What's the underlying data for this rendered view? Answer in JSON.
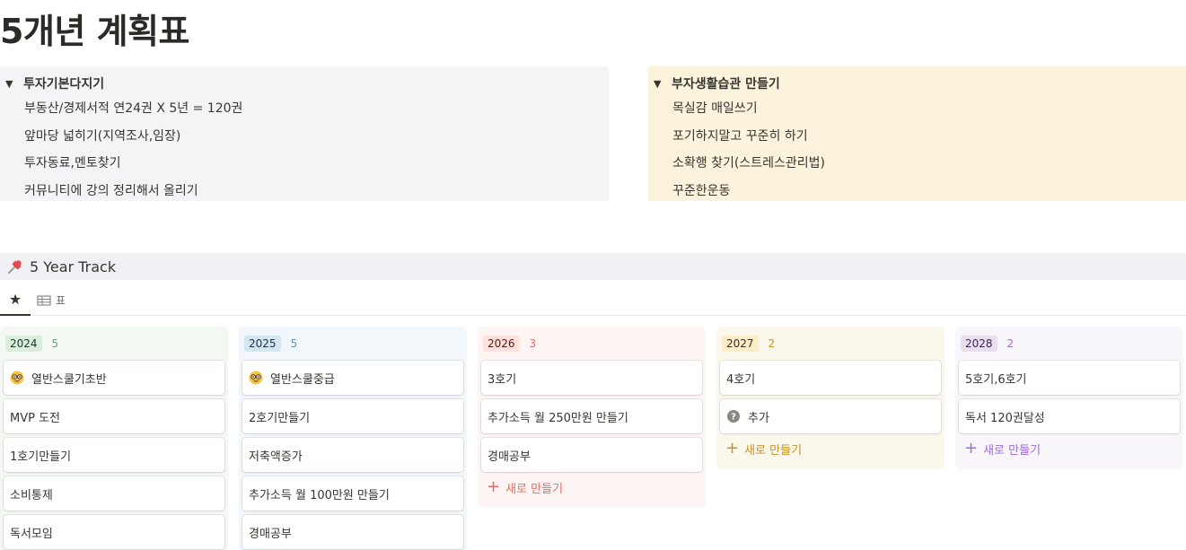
{
  "page": {
    "title": "5개년 계획표"
  },
  "toggles": [
    {
      "title": "투자기본다지기",
      "items": [
        "부동산/경제서적 연24권 X 5년 = 120권",
        "앞마당 넓히기(지역조사,임장)",
        "투자동료,멘토찾기",
        "커뮤니티에 강의 정리해서 올리기"
      ]
    },
    {
      "title": "부자생활습관 만들기",
      "items": [
        "목실감 매일쓰기",
        "포기하지말고 꾸준히 하기",
        "소확행 찾기(스트레스관리법)",
        "꾸준한운동"
      ]
    }
  ],
  "database": {
    "icon": "pushpin-icon",
    "title": "5 Year Track",
    "views": [
      {
        "icon": "star-icon",
        "label": ""
      },
      {
        "icon": "table-icon",
        "label": "표"
      }
    ]
  },
  "board": {
    "add_label": "새로 만들기",
    "columns": [
      {
        "label": "2024",
        "count": "5",
        "colors": {
          "bg": "#f4f8f3",
          "badge_bg": "#dbeddb",
          "badge_text": "#1c3829",
          "count_text": "#6c9b7d",
          "add_text": "#6c9b7d"
        },
        "cards": [
          {
            "title": "열반스쿨기초반",
            "icon": "nerd-face-icon"
          },
          {
            "title": "MVP 도전"
          },
          {
            "title": "1호기만들기"
          },
          {
            "title": "소비통제"
          },
          {
            "title": "독서모임"
          }
        ],
        "show_add": false
      },
      {
        "label": "2025",
        "count": "5",
        "colors": {
          "bg": "#f2f7fb",
          "badge_bg": "#d3e5ef",
          "badge_text": "#183347",
          "count_text": "#5b97bd",
          "add_text": "#5b97bd"
        },
        "cards": [
          {
            "title": "열반스쿨중급",
            "icon": "nerd-face-icon"
          },
          {
            "title": "2호기만들기"
          },
          {
            "title": "저축액증가"
          },
          {
            "title": "추가소득 월 100만원 만들기"
          },
          {
            "title": "경매공부"
          }
        ],
        "show_add": false
      },
      {
        "label": "2026",
        "count": "3",
        "colors": {
          "bg": "#fdf5f3",
          "badge_bg": "#ffe2dd",
          "badge_text": "#5d1715",
          "count_text": "#e16f64",
          "add_text": "#e16f64"
        },
        "cards": [
          {
            "title": "3호기"
          },
          {
            "title": "추가소득 월 250만원 만들기"
          },
          {
            "title": "경매공부"
          }
        ],
        "show_add": true
      },
      {
        "label": "2027",
        "count": "2",
        "colors": {
          "bg": "#faf7ec",
          "badge_bg": "#fdecc8",
          "badge_text": "#402c1b",
          "count_text": "#cb912f",
          "add_text": "#cb912f"
        },
        "cards": [
          {
            "title": "4호기"
          },
          {
            "title": "추가",
            "icon": "question-circle-icon"
          }
        ],
        "show_add": true
      },
      {
        "label": "2028",
        "count": "2",
        "colors": {
          "bg": "#f8f6fb",
          "badge_bg": "#e8deee",
          "badge_text": "#412454",
          "count_text": "#9a6dd7",
          "add_text": "#9a6dd7"
        },
        "cards": [
          {
            "title": "5호기,6호기"
          },
          {
            "title": "독서 120권달성"
          }
        ],
        "show_add": true
      }
    ]
  }
}
